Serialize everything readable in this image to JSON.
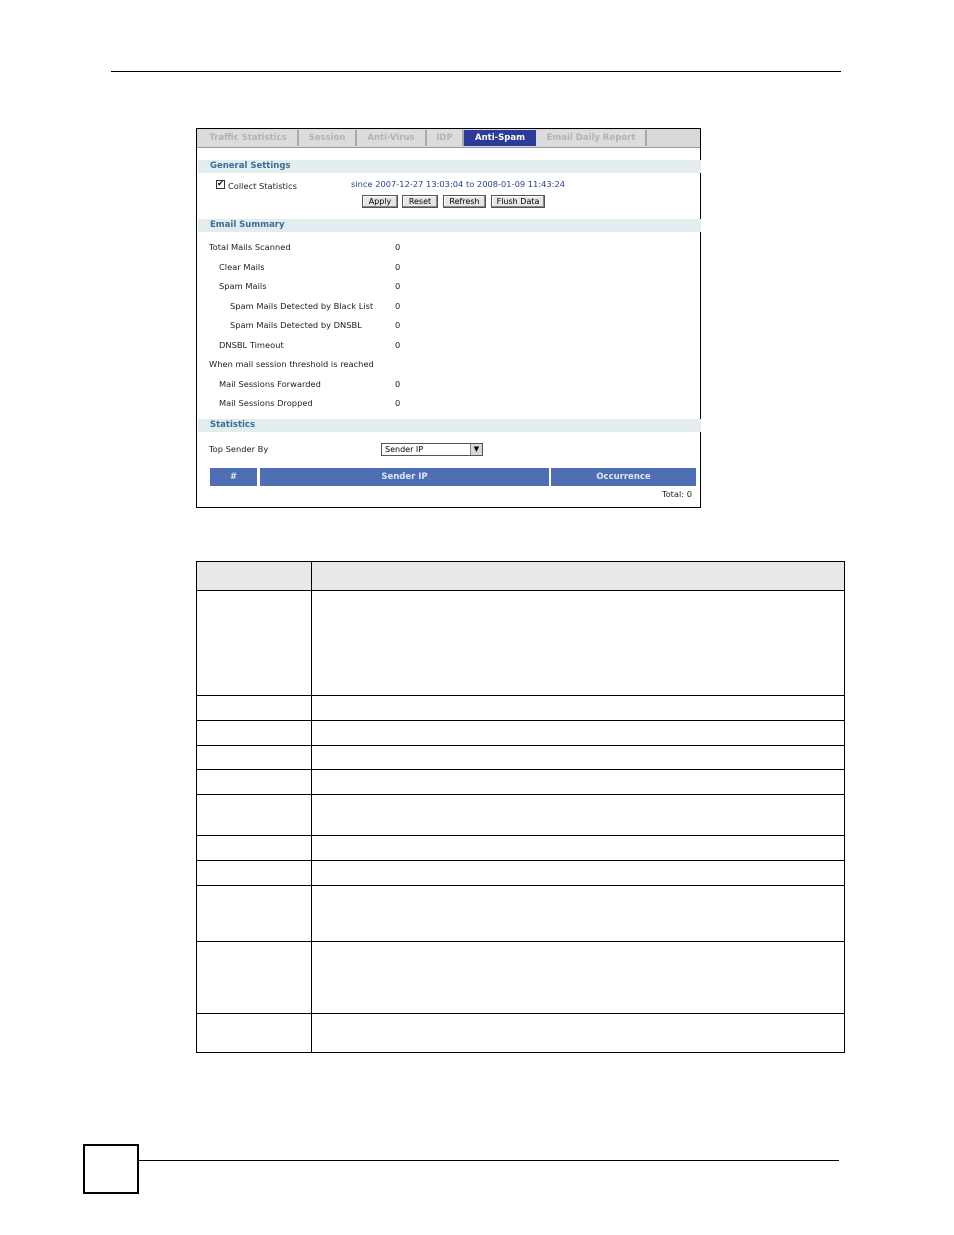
{
  "tabs": [
    {
      "label": "Traffic Statistics",
      "active": false
    },
    {
      "label": "Session",
      "active": false
    },
    {
      "label": "Anti-Virus",
      "active": false
    },
    {
      "label": "IDP",
      "active": false
    },
    {
      "label": "Anti-Spam",
      "active": true
    },
    {
      "label": "Email Daily Report",
      "active": false
    }
  ],
  "general_settings": {
    "title": "General Settings",
    "collect_statistics_label": "Collect Statistics",
    "collect_statistics_checked": true,
    "range_text": "since 2007-12-27 13:03:04 to 2008-01-09 11:43:24",
    "buttons": {
      "apply": "Apply",
      "reset": "Reset",
      "refresh": "Refresh",
      "flush": "Flush Data"
    }
  },
  "email_summary": {
    "title": "Email Summary",
    "rows": [
      {
        "label": "Total Mails Scanned",
        "value": "0"
      },
      {
        "label": "Clear Mails",
        "value": "0"
      },
      {
        "label": "Spam Mails",
        "value": "0"
      },
      {
        "label": "Spam Mails Detected by Black List",
        "value": "0"
      },
      {
        "label": "Spam Mails Detected by DNSBL",
        "value": "0"
      },
      {
        "label": "DNSBL Timeout",
        "value": "0"
      },
      {
        "label": "When mail session threshold is reached",
        "value": ""
      },
      {
        "label": "Mail Sessions Forwarded",
        "value": "0"
      },
      {
        "label": "Mail Sessions Dropped",
        "value": "0"
      }
    ]
  },
  "statistics": {
    "title": "Statistics",
    "top_sender_label": "Top Sender By",
    "top_sender_selected": "Sender IP",
    "columns": [
      "#",
      "Sender IP",
      "Occurrence"
    ],
    "total_text": "Total:  0"
  },
  "icons": {
    "checkbox_mark": "✔",
    "select_arrow": "▼"
  }
}
